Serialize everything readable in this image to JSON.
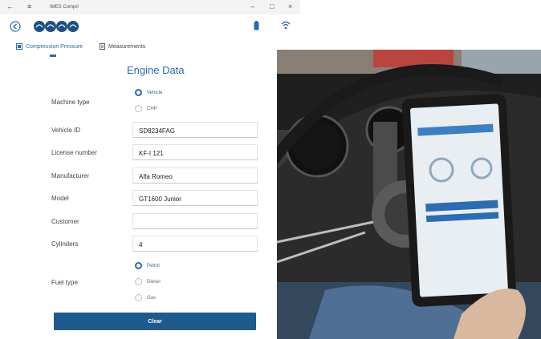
{
  "window": {
    "title": "IMES Compri",
    "back_glyph": "←",
    "menu_glyph": "≡",
    "minimize_glyph": "–",
    "maximize_glyph": "□",
    "close_glyph": "×"
  },
  "header": {
    "logo": "imes",
    "back_glyph": "←"
  },
  "tabs": [
    {
      "label": "Compression Pressure",
      "active": true
    },
    {
      "label": "Measurements",
      "active": false
    }
  ],
  "form": {
    "title": "Engine Data",
    "machine_type": {
      "label": "Machine type",
      "options": [
        "Vehicle",
        "CHP"
      ],
      "selected": "Vehicle"
    },
    "vehicle_id": {
      "label": "Vehicle ID",
      "value": "SD8234FAG"
    },
    "license_number": {
      "label": "License number",
      "value": "KF-I 121"
    },
    "manufacturer": {
      "label": "Manufacturer",
      "value": "Alfa Romeo"
    },
    "model": {
      "label": "Model",
      "value": "GT1600 Junior"
    },
    "customer": {
      "label": "Customer",
      "value": ""
    },
    "cylinders": {
      "label": "Cylinders",
      "value": "4"
    },
    "fuel_type": {
      "label": "Fuel type",
      "options": [
        "Petrol",
        "Diesel",
        "Gas"
      ],
      "selected": "Petrol"
    },
    "clear_label": "Clear"
  },
  "colors": {
    "accent": "#2a6ab3",
    "button": "#1e5b8c"
  },
  "photo": {
    "description_icon": "car-interior-tablet-photo"
  }
}
